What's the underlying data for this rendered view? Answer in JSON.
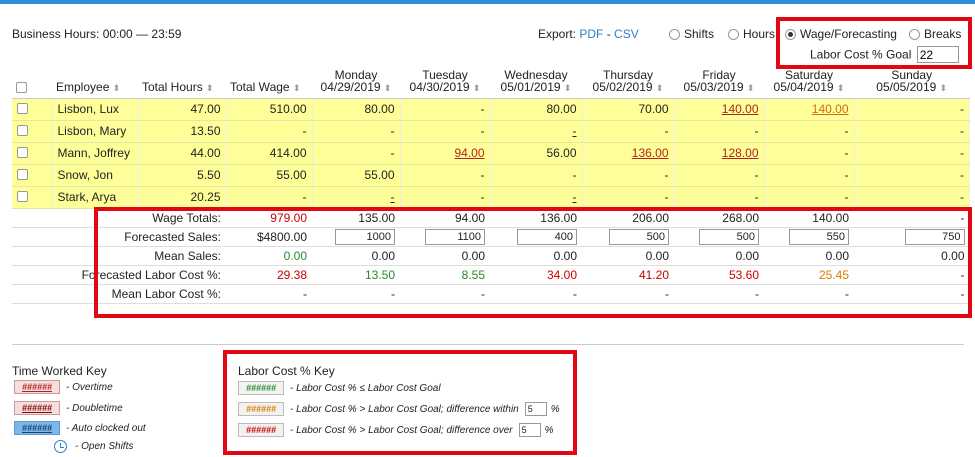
{
  "business_hours": "Business Hours: 00:00 — 23:59",
  "export": {
    "label": "Export:",
    "pdf": "PDF",
    "sep": " - ",
    "csv": "CSV"
  },
  "views": {
    "shifts": "Shifts",
    "hours": "Hours",
    "wage": "Wage/Forecasting",
    "breaks": "Breaks",
    "selected": "wage"
  },
  "goal": {
    "label": "Labor Cost % Goal",
    "value": "22"
  },
  "headers": {
    "employee": "Employee",
    "total_hours": "Total Hours",
    "total_wage": "Total Wage",
    "days": [
      {
        "name": "Monday",
        "date": "04/29/2019"
      },
      {
        "name": "Tuesday",
        "date": "04/30/2019"
      },
      {
        "name": "Wednesday",
        "date": "05/01/2019"
      },
      {
        "name": "Thursday",
        "date": "05/02/2019"
      },
      {
        "name": "Friday",
        "date": "05/03/2019"
      },
      {
        "name": "Saturday",
        "date": "05/04/2019"
      },
      {
        "name": "Sunday",
        "date": "05/05/2019"
      }
    ]
  },
  "employees": [
    {
      "name": "Lisbon, Lux",
      "hours": "47.00",
      "wage": "510.00",
      "days": [
        "80.00",
        "-",
        "80.00",
        "70.00",
        "140.00",
        "140.00",
        "-"
      ],
      "styles": [
        "",
        "",
        "",
        "",
        "ot",
        "ot2",
        ""
      ]
    },
    {
      "name": "Lisbon, Mary",
      "hours": "13.50",
      "wage": "-",
      "days": [
        "-",
        "-",
        "-",
        "-",
        "-",
        "-",
        "-"
      ],
      "styles": [
        "",
        "",
        "u",
        "",
        "",
        "",
        ""
      ]
    },
    {
      "name": "Mann, Joffrey",
      "hours": "44.00",
      "wage": "414.00",
      "days": [
        "-",
        "94.00",
        "56.00",
        "136.00",
        "128.00",
        "-",
        "-"
      ],
      "styles": [
        "",
        "ot",
        "",
        "ot",
        "ot",
        "",
        ""
      ]
    },
    {
      "name": "Snow, Jon",
      "hours": "5.50",
      "wage": "55.00",
      "days": [
        "55.00",
        "-",
        "-",
        "-",
        "-",
        "-",
        "-"
      ],
      "styles": [
        "",
        "",
        "",
        "",
        "",
        "",
        ""
      ]
    },
    {
      "name": "Stark, Arya",
      "hours": "20.25",
      "wage": "-",
      "days": [
        "-",
        "-",
        "-",
        "-",
        "-",
        "-",
        "-"
      ],
      "styles": [
        "u",
        "",
        "u",
        "",
        "",
        "",
        ""
      ]
    }
  ],
  "totals": {
    "wage": {
      "label": "Wage Totals:",
      "total": "979.00",
      "days": [
        "135.00",
        "94.00",
        "136.00",
        "206.00",
        "268.00",
        "140.00",
        "-"
      ]
    },
    "forecast": {
      "label": "Forecasted Sales:",
      "total": "$4800.00",
      "days": [
        "1000",
        "1100",
        "400",
        "500",
        "500",
        "550",
        "750"
      ]
    },
    "mean_sales": {
      "label": "Mean Sales:",
      "total": "0.00",
      "days": [
        "0.00",
        "0.00",
        "0.00",
        "0.00",
        "0.00",
        "0.00",
        "0.00"
      ]
    },
    "flc": {
      "label": "Forecasted Labor Cost %:",
      "total": "29.38",
      "days": [
        "13.50",
        "8.55",
        "34.00",
        "41.20",
        "53.60",
        "25.45",
        "-"
      ],
      "colors": [
        "red",
        "green",
        "green",
        "red",
        "red",
        "red",
        "orange",
        ""
      ]
    },
    "mlc": {
      "label": "Mean Labor Cost %:",
      "total": "-",
      "days": [
        "-",
        "-",
        "-",
        "-",
        "-",
        "-",
        "-"
      ]
    }
  },
  "time_key": {
    "title": "Time Worked Key",
    "swatch": "######",
    "overtime": "- Overtime",
    "doubletime": "- Doubletime",
    "auto": "- Auto clocked out",
    "open": "- Open Shifts"
  },
  "labor_key": {
    "title": "Labor Cost % Key",
    "swatch": "######",
    "le": "- Labor Cost % ≤ Labor Cost Goal",
    "within": "- Labor Cost % > Labor Cost Goal; difference within",
    "within_val": "5",
    "over": "- Labor Cost % > Labor Cost Goal; difference over",
    "over_val": "5",
    "pct": "%"
  }
}
